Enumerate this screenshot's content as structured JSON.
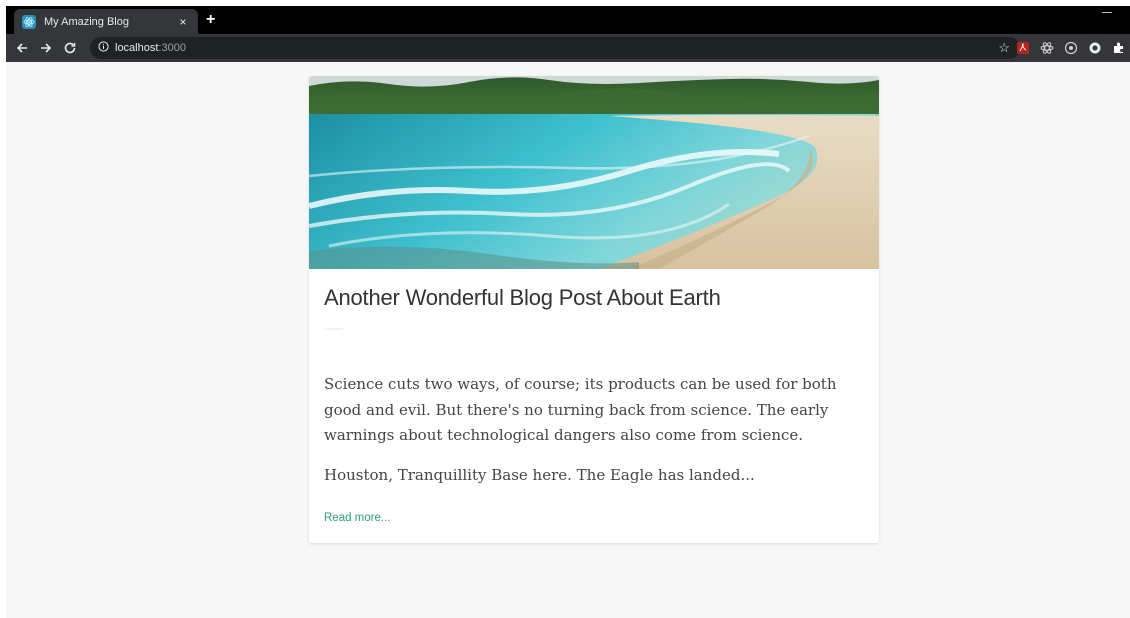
{
  "browser": {
    "tab": {
      "title": "My Amazing Blog"
    },
    "new_tab_symbol": "+",
    "close_symbol": "×",
    "address": {
      "host": "localhost",
      "port": ":3000"
    },
    "icons": [
      "back-arrow-icon",
      "forward-arrow-icon",
      "reload-icon",
      "info-icon",
      "star-icon",
      "pdf-extension-icon",
      "react-extension-icon",
      "extension-circle-icon",
      "record-extension-icon",
      "puzzle-icon"
    ]
  },
  "post": {
    "title": "Another Wonderful Blog Post About Earth",
    "excerpt": "Science cuts two ways, of course; its products can be used for both good and evil. But there's no turning back from science. The early warnings about technological dangers also come from science.",
    "excerpt_2": "Houston, Tranquillity Base here. The Eagle has landed...",
    "read_more": "Read more..."
  },
  "colors": {
    "accent": "#2fa36b",
    "tab_strip": "#000000",
    "toolbar": "#35363a",
    "page_bg": "#f7f7f7"
  }
}
